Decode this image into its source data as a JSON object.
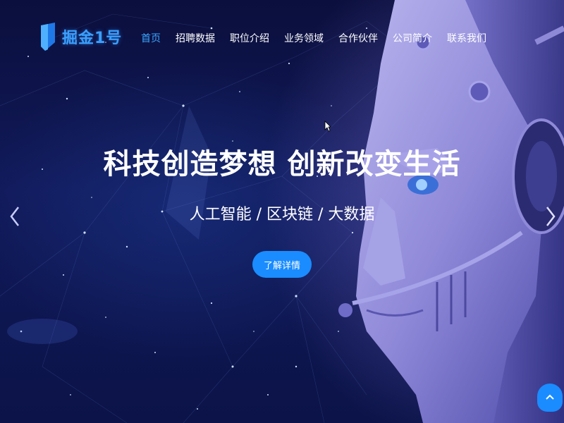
{
  "logo": {
    "text": "掘金1号",
    "icon": "shield-logo-icon"
  },
  "nav": {
    "items": [
      {
        "label": "首页",
        "active": true
      },
      {
        "label": "招聘数据",
        "active": false
      },
      {
        "label": "职位介绍",
        "active": false
      },
      {
        "label": "业务领域",
        "active": false
      },
      {
        "label": "合作伙伴",
        "active": false
      },
      {
        "label": "公司简介",
        "active": false
      },
      {
        "label": "联系我们",
        "active": false
      }
    ]
  },
  "hero": {
    "headline": "科技创造梦想 创新改变生活",
    "subline": "人工智能 / 区块链 / 大数据",
    "cta_label": "了解详情"
  },
  "controls": {
    "prev_icon": "chevron-left-icon",
    "next_icon": "chevron-right-icon",
    "back_to_top_icon": "arrow-up-icon"
  },
  "colors": {
    "accent": "#1a8cff",
    "nav_active": "#3aa7ff",
    "background": "#0b0f3d"
  }
}
